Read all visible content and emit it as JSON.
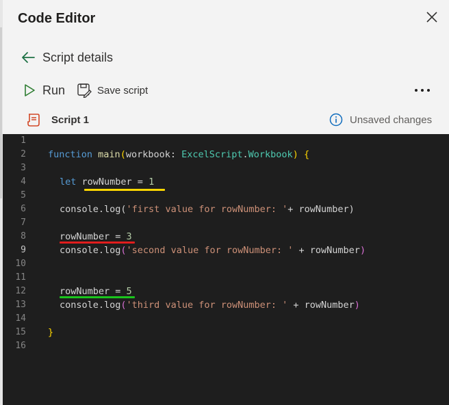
{
  "panel": {
    "title": "Code Editor",
    "back_label": "Script details",
    "run_label": "Run",
    "save_label": "Save script",
    "script_name": "Script 1",
    "status": "Unsaved changes"
  },
  "icons": {
    "close": "close-icon",
    "back": "arrow-left-icon",
    "run": "play-icon",
    "save": "save-script-icon",
    "more": "more-horizontal-icon",
    "script": "script-file-icon",
    "info": "info-icon"
  },
  "colors": {
    "accent": "#1e7145",
    "run_icon": "#2e7d32",
    "script_icon": "#d24726",
    "info_icon": "#0f6cbd",
    "editor_bg": "#1e1e1e",
    "underline_1": "#ffd700",
    "underline_2": "#e11d1d",
    "underline_3": "#19c51c"
  },
  "editor": {
    "line_numbers": [
      "1",
      "2",
      "3",
      "4",
      "5",
      "6",
      "7",
      "8",
      "9",
      "10",
      "11",
      "12",
      "13",
      "14",
      "15",
      "16"
    ],
    "code": {
      "l2": {
        "kw": "function",
        "fn": "main",
        "open": "(",
        "param": "workbook: ",
        "type1": "ExcelScript",
        "dot": ".",
        "type2": "Workbook",
        "close": ")",
        "brace": " {"
      },
      "l4": {
        "kw": "let",
        "var": "rowNumber = ",
        "num": "1"
      },
      "l6": {
        "pre": "console.log(",
        "str": "'first value for rowNumber: '",
        "post": "+ rowNumber)"
      },
      "l8": {
        "var": "rowNumber = ",
        "num": "3"
      },
      "l9": {
        "pre": "console.log",
        "open": "(",
        "str": "'second value for rowNumber: '",
        "post": " + rowNumber",
        "close": ")"
      },
      "l12": {
        "var": "rowNumber = ",
        "num": "5"
      },
      "l13": {
        "pre": "console.log",
        "open": "(",
        "str": "'third value for rowNumber: '",
        "post": " + rowNumber",
        "close": ")"
      },
      "l15": {
        "brace": "}"
      }
    }
  }
}
